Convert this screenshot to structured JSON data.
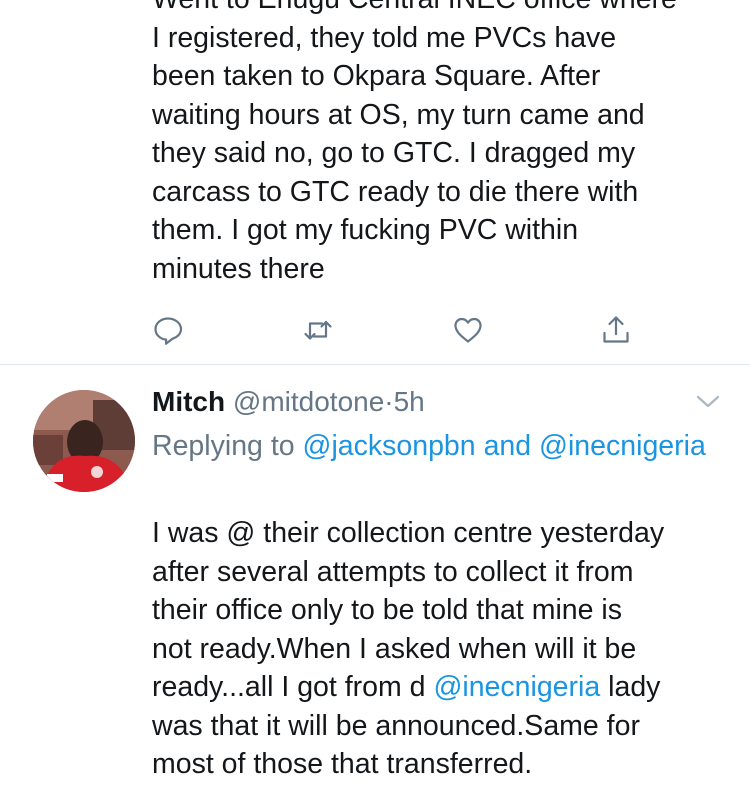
{
  "tweet1": {
    "text": "Went to Enugu Central INEC office where\nI registered, they told me PVCs have\nbeen taken to Okpara Square. After\nwaiting hours at OS, my turn came and\nthey said no, go to GTC. I dragged my\ncarcass to GTC ready to die there with\nthem. I got my fucking PVC within\nminutes there"
  },
  "actions": [
    "reply-icon",
    "retweet-icon",
    "like-icon",
    "share-icon"
  ],
  "tweet2": {
    "name": "Mitch",
    "handle": "@mitdotone",
    "separator": "·",
    "time": "5h",
    "replying_prefix": "Replying to",
    "reply_to_1": "@jacksonpbn",
    "reply_and": "and",
    "reply_to_2": "@inecnigeria",
    "text_part1": "I was @ their collection centre yesterday\nafter several attempts to collect it from\ntheir office only to be told that mine is\nnot ready.When I asked when will it be\nready...all I got from d ",
    "mention": "@inecnigeria",
    "text_part2": " lady\nwas that it will be announced.Same for\nmost of those that transferred."
  },
  "colors": {
    "link": "#1b95e0",
    "muted": "#657786",
    "text": "#14171a",
    "divider": "#e1e8ed"
  }
}
